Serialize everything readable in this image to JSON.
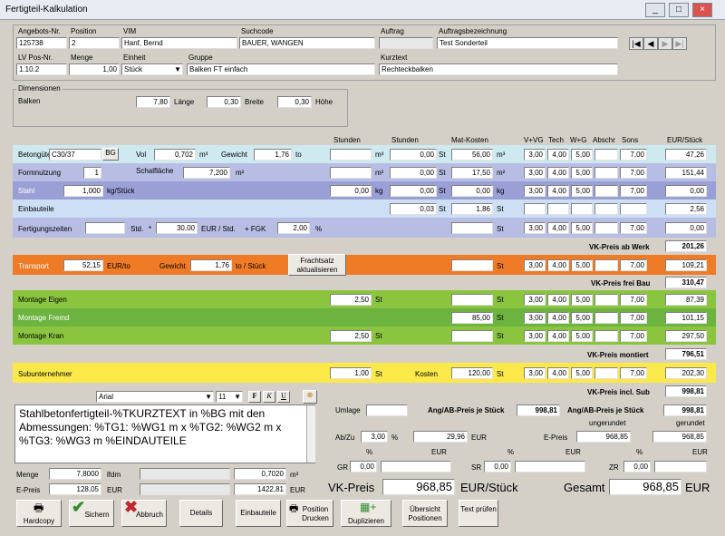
{
  "window": {
    "title": "Fertigteil-Kalkulation",
    "min": "_",
    "max": "□",
    "close": "×"
  },
  "header": {
    "angebot_label": "Angebots-Nr.",
    "angebot": "125738",
    "position_label": "Position",
    "position": "2",
    "vim_label": "VIM",
    "vim": "Hanf, Bernd",
    "suchcode_label": "Suchcode",
    "suchcode": "BAUER, WANGEN",
    "auftrag_label": "Auftrag",
    "auftrag": "",
    "auftragsbez_label": "Auftragsbezeichnung",
    "auftragsbez": "Test Sonderteil",
    "lvpos_label": "LV Pos-Nr.",
    "lvpos": "1.10.2",
    "menge_label": "Menge",
    "menge": "1,00",
    "einheit_label": "Einheit",
    "einheit": "Stück",
    "gruppe_label": "Gruppe",
    "gruppe": "Balken FT einfach",
    "kurztext_label": "Kurztext",
    "kurztext": "Rechteckbalken"
  },
  "dimensionen": {
    "label": "Dimensionen",
    "name": "Balken",
    "v1": "7,80",
    "l1": "Länge",
    "v2": "0,30",
    "l2": "Breite",
    "v3": "0,30",
    "l3": "Höhe"
  },
  "columns": {
    "stunden1": "Stunden",
    "stunden2": "Stunden",
    "matkosten": "Mat-Kosten",
    "vvg": "V+VG",
    "tech": "Tech",
    "wg": "W+G",
    "abschr": "Abschr",
    "sons": "Sons",
    "eur": "EUR/Stück"
  },
  "rows": {
    "beton": {
      "label": "Betongüte",
      "guete": "C30/37",
      "bg": "BG",
      "vol_label": "Vol",
      "vol": "0,702",
      "vol_unit": "m³",
      "gew_label": "Gewicht",
      "gew": "1,76",
      "gew_unit": "to",
      "m3": "m³",
      "std2": "0,00",
      "st": "St",
      "mat": "56,00",
      "mat_unit": "m³",
      "vvg": "3,00",
      "tech": "4,00",
      "wg": "5,00",
      "sons": "7,00",
      "eur": "47,26"
    },
    "form": {
      "label": "Formnutzung",
      "n": "1",
      "sf_label": "Schalfläche",
      "sf": "7,200",
      "sf_unit": "m²",
      "m2": "m²",
      "std2": "0,00",
      "st": "St",
      "mat": "17,50",
      "mat_unit": "m²",
      "vvg": "3,00",
      "tech": "4,00",
      "wg": "5,00",
      "sons": "7,00",
      "eur": "151,44"
    },
    "stahl": {
      "label": "Stahl",
      "kg": "1,000",
      "kg_unit": "kg/Stück",
      "std1": "0,00",
      "kg1": "kg",
      "std2": "0,00",
      "st": "St",
      "mat": "0,00",
      "mat_unit": "kg",
      "vvg": "3,00",
      "tech": "4,00",
      "wg": "5,00",
      "sons": "7,00",
      "eur": "0,00"
    },
    "einbau": {
      "label": "Einbauteile",
      "std2": "0,03",
      "st": "St",
      "mat": "1,86",
      "mat_unit": "St",
      "eur": "2,56"
    },
    "fertig": {
      "label": "Fertigungszeiten",
      "std_label": "Std.",
      "mal": "*",
      "rate": "30,00",
      "rate_unit": "EUR / Std.",
      "fgk_label": "+ FGK",
      "fgk": "2,00",
      "pct": "%",
      "st": "St",
      "vvg": "3,00",
      "tech": "4,00",
      "wg": "5,00",
      "sons": "7,00",
      "eur": "0,00"
    },
    "sum_werk": {
      "label": "VK-Preis ab Werk",
      "value": "201,26"
    },
    "transport": {
      "label": "Transport",
      "rate": "52,15",
      "rate_unit": "EUR/to",
      "gew_label": "Gewicht",
      "gew": "1,76",
      "gew_unit": "to / Stück",
      "btn": "Frachtsatz aktualisieren",
      "st": "St",
      "vvg": "3,00",
      "tech": "4,00",
      "wg": "5,00",
      "sons": "7,00",
      "eur": "109,21"
    },
    "sum_bau": {
      "label": "VK-Preis frei Bau",
      "value": "310,47"
    },
    "m_eigen": {
      "label": "Montage Eigen",
      "std": "2,50",
      "st_l": "St",
      "st": "St",
      "vvg": "3,00",
      "tech": "4,00",
      "wg": "5,00",
      "sons": "7,00",
      "eur": "87,39"
    },
    "m_fremd": {
      "label": "Montage Fremd",
      "mat": "85,00",
      "st": "St",
      "vvg": "3,00",
      "tech": "4,00",
      "wg": "5,00",
      "sons": "7,00",
      "eur": "101,15"
    },
    "m_kran": {
      "label": "Montage Kran",
      "std": "2,50",
      "st_l": "St",
      "st": "St",
      "vvg": "3,00",
      "tech": "4,00",
      "wg": "5,00",
      "sons": "7,00",
      "eur": "297,50"
    },
    "sum_mont": {
      "label": "VK-Preis montiert",
      "value": "796,51"
    },
    "sub": {
      "label": "Subunternehmer",
      "n": "1,00",
      "st_l": "St",
      "kosten_label": "Kosten",
      "kosten": "120,00",
      "st": "St",
      "vvg": "3,00",
      "tech": "4,00",
      "wg": "5,00",
      "sons": "7,00",
      "eur": "202,30"
    },
    "sum_sub": {
      "label": "VK-Preis incl. Sub",
      "value": "998,81"
    }
  },
  "editor": {
    "font": "Arial",
    "size": "11",
    "text": "Stahlbetonfertigteil-%TKURZTEXT in %BG mit den Abmessungen: %TG1: %WG1 m x %TG2: %WG2 m x %TG3: %WG3 m %EINDAUTEILE"
  },
  "calc": {
    "umlage_label": "Umlage",
    "angab_label": "Ang/AB-Preis je Stück",
    "angab": "998,81",
    "angab2_label": "Ang/AB-Preis je Stück",
    "angab2": "998,81",
    "abzu_label": "Ab/Zu",
    "abzu_pct": "3,00",
    "pct": "%",
    "abzu_val": "29,96",
    "eur": "EUR",
    "ungerundet": "ungerundet",
    "gerundet": "gerundet",
    "epreis_label": "E-Preis",
    "epreis_u": "968,85",
    "epreis_g": "968,85",
    "pct_h": "%",
    "eur_h": "EUR",
    "gr_label": "GR",
    "gr": "0,00",
    "sr_label": "SR",
    "sr": "0,00",
    "zr_label": "ZR",
    "zr": "0,00"
  },
  "bottom": {
    "menge_label": "Menge",
    "menge": "7,8000",
    "menge_unit": "lfdm",
    "m3val": "0,7020",
    "m3": "m³",
    "epreis_label": "E-Preis",
    "epreis": "128,05",
    "eur1": "EUR",
    "total": "1422,81",
    "eur2": "EUR",
    "vk_label": "VK-Preis",
    "vk": "968,85",
    "vk_unit": "EUR/Stück",
    "ges_label": "Gesamt",
    "ges": "968,85",
    "ges_unit": "EUR"
  },
  "buttons": {
    "hardcopy": "Hardcopy",
    "sichern": "Sichern",
    "abbruch": "Abbruch",
    "details": "Details",
    "einbauteile": "Einbauteile",
    "pos_drucken": "Position Drucken",
    "duplizieren": "Duplizieren",
    "uebersicht": "Übersicht Positionen",
    "text_pruefen": "Text prüfen"
  },
  "colors": {
    "cyan": "#cfe9f1",
    "lavender": "#b8bde4",
    "blue": "#9aa0d6",
    "einbau": "#ccdff4",
    "orange": "#f07b26",
    "green": "#8bc53f",
    "green2": "#6db33f",
    "yellow": "#fbe94a"
  }
}
